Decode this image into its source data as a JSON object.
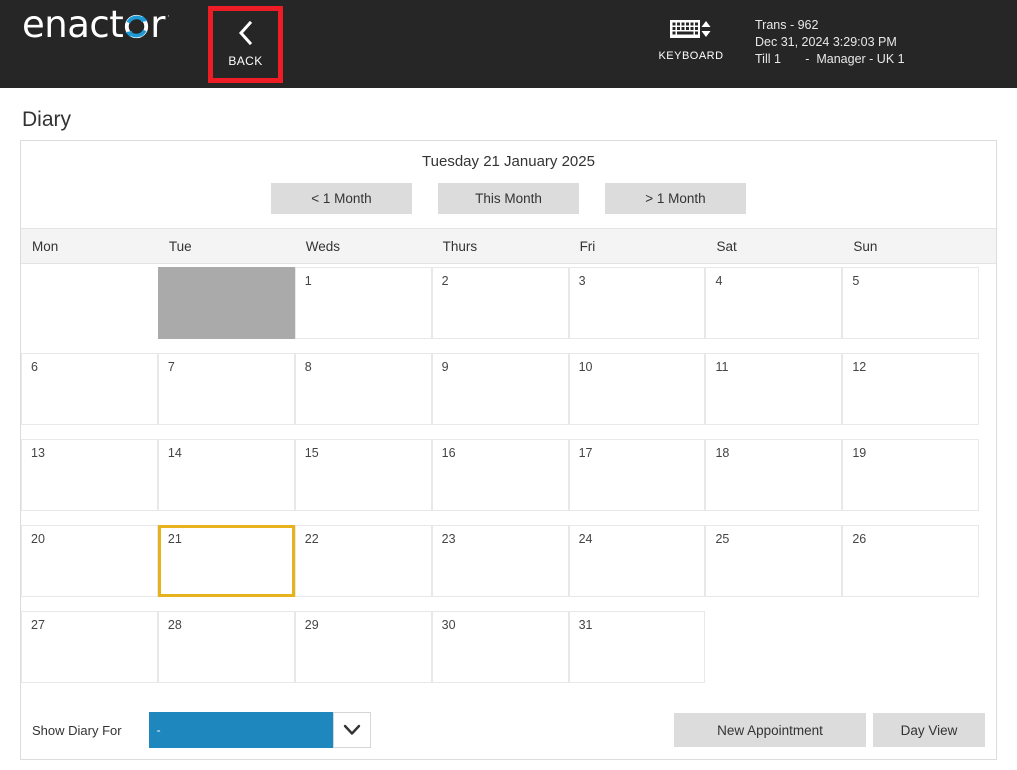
{
  "header": {
    "logo_text_before": "enact",
    "logo_text_after": "r",
    "logo_mark": "circular-arrow-o",
    "logo_tm": "·",
    "back_button": {
      "label": "BACK",
      "icon": "chevron-left-icon",
      "glyph": "‹"
    },
    "keyboard_button": {
      "label": "KEYBOARD",
      "icon": "keyboard-icon"
    },
    "transaction": {
      "line1": "Trans - 962",
      "line2": "Dec 31, 2024 3:29:03 PM",
      "line3": "Till 1       -  Manager - UK 1"
    },
    "colors": {
      "background": "#262626",
      "accent_red": "#ee1c24",
      "brand_blue": "#1e87bd"
    }
  },
  "page": {
    "title": "Diary"
  },
  "calendar": {
    "title": "Tuesday 21 January 2025",
    "nav": {
      "prev_month": "< 1 Month",
      "this_month": "This Month",
      "next_month": "> 1 Month"
    },
    "day_headers": [
      "Mon",
      "Tue",
      "Weds",
      "Thurs",
      "Fri",
      "Sat",
      "Sun"
    ],
    "selected_day": "21",
    "selected_color": "#e8b21c",
    "blocked_color": "#aaaaaa",
    "rows": [
      [
        {
          "label": "",
          "state": "empty"
        },
        {
          "label": "",
          "state": "blocked"
        },
        {
          "label": "1",
          "state": "normal"
        },
        {
          "label": "2",
          "state": "normal"
        },
        {
          "label": "3",
          "state": "normal"
        },
        {
          "label": "4",
          "state": "normal"
        },
        {
          "label": "5",
          "state": "normal"
        }
      ],
      [
        {
          "label": "6",
          "state": "normal"
        },
        {
          "label": "7",
          "state": "normal"
        },
        {
          "label": "8",
          "state": "normal"
        },
        {
          "label": "9",
          "state": "normal"
        },
        {
          "label": "10",
          "state": "normal"
        },
        {
          "label": "11",
          "state": "normal"
        },
        {
          "label": "12",
          "state": "normal"
        }
      ],
      [
        {
          "label": "13",
          "state": "normal"
        },
        {
          "label": "14",
          "state": "normal"
        },
        {
          "label": "15",
          "state": "normal"
        },
        {
          "label": "16",
          "state": "normal"
        },
        {
          "label": "17",
          "state": "normal"
        },
        {
          "label": "18",
          "state": "normal"
        },
        {
          "label": "19",
          "state": "normal"
        }
      ],
      [
        {
          "label": "20",
          "state": "normal"
        },
        {
          "label": "21",
          "state": "selected"
        },
        {
          "label": "22",
          "state": "normal"
        },
        {
          "label": "23",
          "state": "normal"
        },
        {
          "label": "24",
          "state": "normal"
        },
        {
          "label": "25",
          "state": "normal"
        },
        {
          "label": "26",
          "state": "normal"
        }
      ],
      [
        {
          "label": "27",
          "state": "normal"
        },
        {
          "label": "28",
          "state": "normal"
        },
        {
          "label": "29",
          "state": "normal"
        },
        {
          "label": "30",
          "state": "normal"
        },
        {
          "label": "31",
          "state": "normal"
        },
        {
          "label": "",
          "state": "empty"
        },
        {
          "label": "",
          "state": "empty"
        }
      ]
    ]
  },
  "footer": {
    "show_diary_label": "Show Diary For",
    "dropdown_value": "-",
    "dropdown_icon": "chevron-down-icon",
    "new_appointment": "New Appointment",
    "day_view": "Day View"
  }
}
